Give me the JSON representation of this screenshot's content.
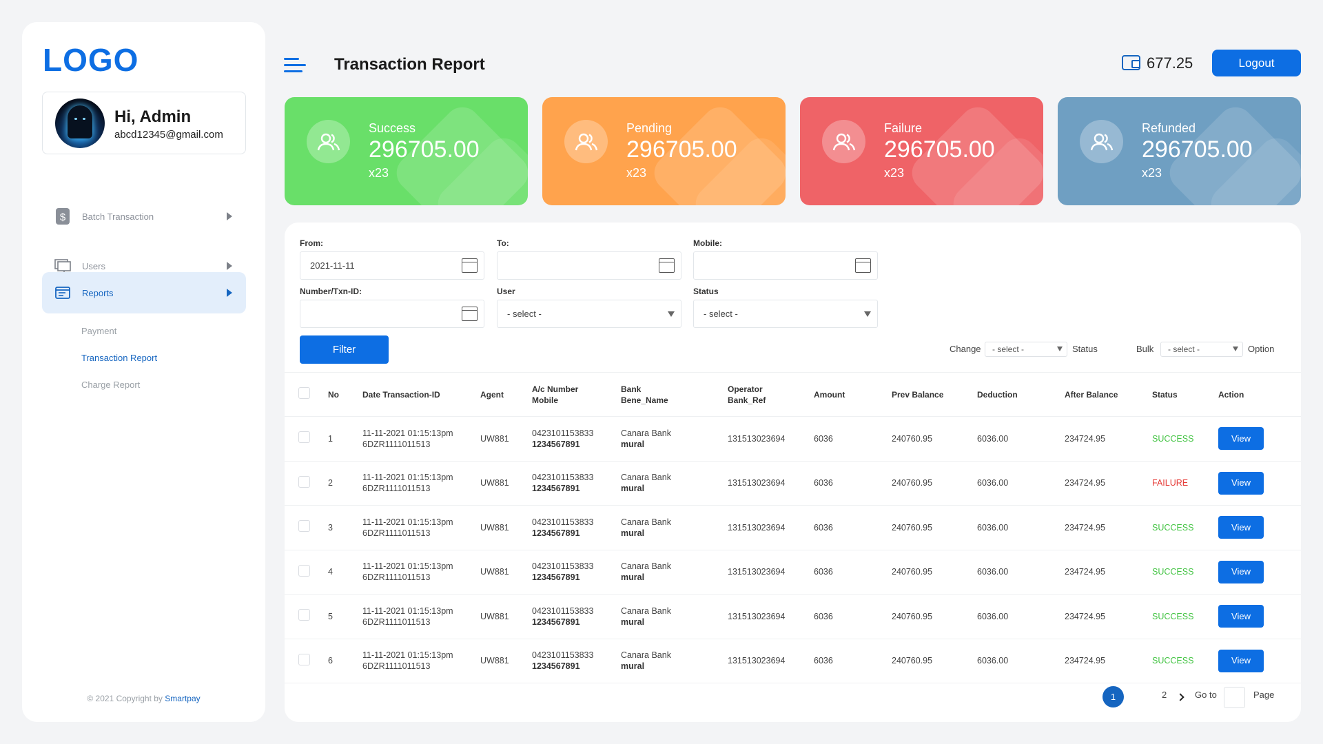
{
  "sidebar": {
    "logo": "LOGO",
    "profile": {
      "greeting": "Hi, Admin",
      "email": "abcd12345@gmail.com"
    },
    "nav": [
      {
        "label": "Batch Transaction",
        "icon": "dollar-icon"
      },
      {
        "label": "Users",
        "icon": "monitor-icon"
      },
      {
        "label": "Reports",
        "icon": "report-icon",
        "active": true
      }
    ],
    "submenu": [
      "Payment",
      "Transaction Report",
      "Charge Report"
    ],
    "copyright_prefix": "© 2021 Copyright by ",
    "copyright_brand": "Smartpay"
  },
  "header": {
    "title": "Transaction Report",
    "balance": "677.25",
    "logout": "Logout"
  },
  "cards": [
    {
      "label": "Success",
      "value": "296705.00",
      "count": "x23",
      "color": "#69df69"
    },
    {
      "label": "Pending",
      "value": "296705.00",
      "count": "x23",
      "color": "#ffa34d"
    },
    {
      "label": "Failure",
      "value": "296705.00",
      "count": "x23",
      "color": "#ef6367"
    },
    {
      "label": "Refunded",
      "value": "296705.00",
      "count": "x23",
      "color": "#6f9fc2"
    }
  ],
  "filters": {
    "from_label": "From:",
    "from_value": "2021-11-11",
    "to_label": "To:",
    "to_value": "",
    "mobile_label": "Mobile:",
    "mobile_value": "",
    "txn_label": "Number/Txn-ID:",
    "txn_value": "",
    "user_label": "User",
    "user_value": "- select -",
    "status_label": "Status",
    "status_value": "- select -",
    "filter_button": "Filter",
    "change_label": "Change",
    "change_value": "- select -",
    "change_suffix": "Status",
    "bulk_label": "Bulk",
    "bulk_value": "- select -",
    "bulk_suffix": "Option"
  },
  "table": {
    "headers": {
      "no": "No",
      "date": "Date Transaction-ID",
      "agent": "Agent",
      "acc1": "A/c Number",
      "acc2": "Mobile",
      "bank1": "Bank",
      "bank2": "Bene_Name",
      "op1": "Operator",
      "op2": "Bank_Ref",
      "amount": "Amount",
      "prev": "Prev Balance",
      "deduction": "Deduction",
      "after": "After Balance",
      "status": "Status",
      "action": "Action"
    },
    "rows": [
      {
        "no": "1",
        "date": "11-11-2021 01:15:13pm",
        "txn": "6DZR1111011513",
        "agent": "UW881",
        "acc": "0423101153833",
        "mobile": "1234567891",
        "bank": "Canara Bank",
        "bene": "mural",
        "ref": "131513023694",
        "amount": "6036",
        "prev": "240760.95",
        "deduction": "6036.00",
        "after": "234724.95",
        "status": "SUCCESS",
        "action": "View"
      },
      {
        "no": "2",
        "date": "11-11-2021 01:15:13pm",
        "txn": "6DZR1111011513",
        "agent": "UW881",
        "acc": "0423101153833",
        "mobile": "1234567891",
        "bank": "Canara Bank",
        "bene": "mural",
        "ref": "131513023694",
        "amount": "6036",
        "prev": "240760.95",
        "deduction": "6036.00",
        "after": "234724.95",
        "status": "FAILURE",
        "action": "View"
      },
      {
        "no": "3",
        "date": "11-11-2021 01:15:13pm",
        "txn": "6DZR1111011513",
        "agent": "UW881",
        "acc": "0423101153833",
        "mobile": "1234567891",
        "bank": "Canara Bank",
        "bene": "mural",
        "ref": "131513023694",
        "amount": "6036",
        "prev": "240760.95",
        "deduction": "6036.00",
        "after": "234724.95",
        "status": "SUCCESS",
        "action": "View"
      },
      {
        "no": "4",
        "date": "11-11-2021 01:15:13pm",
        "txn": "6DZR1111011513",
        "agent": "UW881",
        "acc": "0423101153833",
        "mobile": "1234567891",
        "bank": "Canara Bank",
        "bene": "mural",
        "ref": "131513023694",
        "amount": "6036",
        "prev": "240760.95",
        "deduction": "6036.00",
        "after": "234724.95",
        "status": "SUCCESS",
        "action": "View"
      },
      {
        "no": "5",
        "date": "11-11-2021 01:15:13pm",
        "txn": "6DZR1111011513",
        "agent": "UW881",
        "acc": "0423101153833",
        "mobile": "1234567891",
        "bank": "Canara Bank",
        "bene": "mural",
        "ref": "131513023694",
        "amount": "6036",
        "prev": "240760.95",
        "deduction": "6036.00",
        "after": "234724.95",
        "status": "SUCCESS",
        "action": "View"
      },
      {
        "no": "6",
        "date": "11-11-2021 01:15:13pm",
        "txn": "6DZR1111011513",
        "agent": "UW881",
        "acc": "0423101153833",
        "mobile": "1234567891",
        "bank": "Canara Bank",
        "bene": "mural",
        "ref": "131513023694",
        "amount": "6036",
        "prev": "240760.95",
        "deduction": "6036.00",
        "after": "234724.95",
        "status": "SUCCESS",
        "action": "View"
      }
    ]
  },
  "pagination": {
    "current": "1",
    "next_page": "2",
    "goto": "Go to",
    "page": "Page"
  },
  "colors": {
    "primary": "#0d6ee3",
    "success": "#43c443",
    "failure": "#e53935"
  }
}
